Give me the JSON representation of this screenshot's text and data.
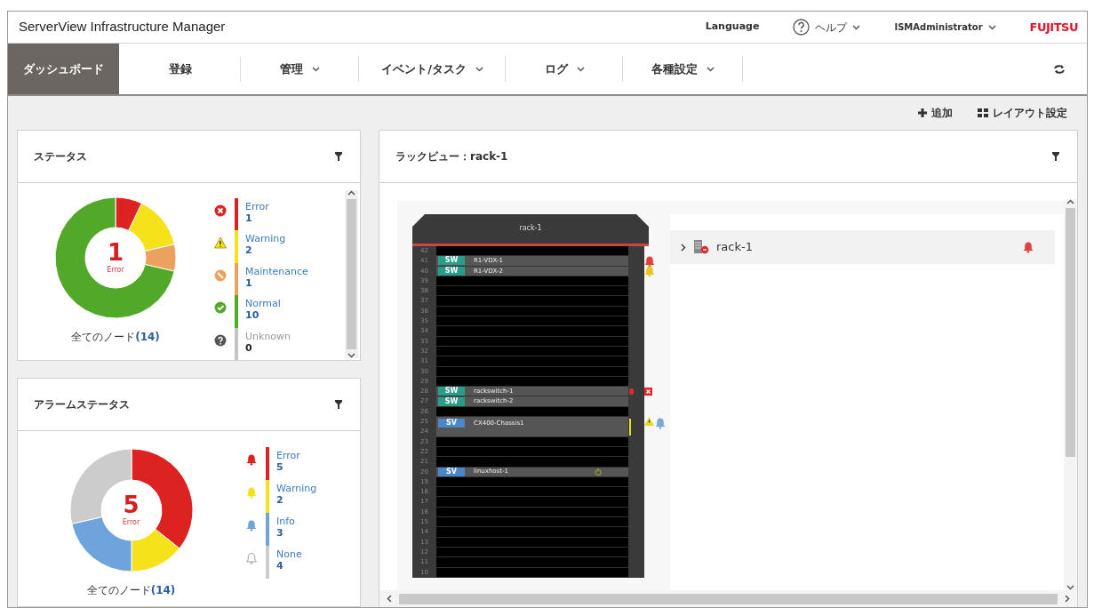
{
  "header": {
    "title": "ServerView Infrastructure Manager",
    "language": "Language",
    "help": "ヘルプ",
    "user": "ISMAdministrator",
    "logo": "FUJITSU"
  },
  "nav": {
    "tabs": [
      {
        "label": "ダッシュボード",
        "selected": true,
        "dropdown": false
      },
      {
        "label": "登録",
        "selected": false,
        "dropdown": false
      },
      {
        "label": "管理",
        "selected": false,
        "dropdown": true
      },
      {
        "label": "イベント/タスク",
        "selected": false,
        "dropdown": true
      },
      {
        "label": "ログ",
        "selected": false,
        "dropdown": true
      },
      {
        "label": "各種設定",
        "selected": false,
        "dropdown": true
      }
    ]
  },
  "toolbar": [
    {
      "kind": "add",
      "label": "追加"
    },
    {
      "kind": "layout",
      "label": "レイアウト設定"
    }
  ],
  "status_card": {
    "title": "ステータス",
    "center_value": "1",
    "center_label": "Error",
    "footer_label": "全てのノード",
    "footer_count": "(14)",
    "legend": [
      {
        "kind": "error",
        "label": "Error",
        "count": "1",
        "color": "#dd2222",
        "disabled": false
      },
      {
        "kind": "warning",
        "label": "Warning",
        "count": "2",
        "color": "#f5e21a",
        "disabled": false
      },
      {
        "kind": "maintenance",
        "label": "Maintenance",
        "count": "1",
        "color": "#eca25e",
        "disabled": false
      },
      {
        "kind": "normal",
        "label": "Normal",
        "count": "10",
        "color": "#52a828",
        "disabled": false
      },
      {
        "kind": "unknown",
        "label": "Unknown",
        "count": "0",
        "color": "#c4c4c4",
        "disabled": true
      }
    ]
  },
  "alarm_card": {
    "title": "アラームステータス",
    "center_value": "5",
    "center_label": "Error",
    "footer_label": "全てのノード",
    "footer_count": "(14)",
    "legend": [
      {
        "kind": "error-bell",
        "label": "Error",
        "count": "5",
        "color": "#dd2222",
        "disabled": false
      },
      {
        "kind": "warning-bell",
        "label": "Warning",
        "count": "2",
        "color": "#f5e21a",
        "disabled": false
      },
      {
        "kind": "info-bell",
        "label": "Info",
        "count": "3",
        "color": "#6fa3dc",
        "disabled": false
      },
      {
        "kind": "none-bell",
        "label": "None",
        "count": "4",
        "color": "#cccccc",
        "disabled": false
      }
    ]
  },
  "rack_view": {
    "title": "ラックビュー：rack-1",
    "rack": {
      "name": "rack-1",
      "slots": [
        {
          "numbers": [
            "42"
          ],
          "kind": "empty"
        },
        {
          "numbers": [
            "41"
          ],
          "kind": "switch",
          "tag": "SW",
          "name": "R1-VDX-1",
          "alarms": [
            {
              "kind": "error-bell"
            }
          ]
        },
        {
          "numbers": [
            "40"
          ],
          "kind": "switch",
          "tag": "SW",
          "name": "R1-VDX-2",
          "alarms": [
            {
              "kind": "warning-bell"
            }
          ]
        },
        {
          "numbers": [
            "39"
          ],
          "kind": "empty"
        },
        {
          "numbers": [
            "38"
          ],
          "kind": "empty"
        },
        {
          "numbers": [
            "37"
          ],
          "kind": "empty"
        },
        {
          "numbers": [
            "36"
          ],
          "kind": "empty"
        },
        {
          "numbers": [
            "35"
          ],
          "kind": "empty"
        },
        {
          "numbers": [
            "34"
          ],
          "kind": "empty"
        },
        {
          "numbers": [
            "33"
          ],
          "kind": "empty"
        },
        {
          "numbers": [
            "32"
          ],
          "kind": "empty"
        },
        {
          "numbers": [
            "31"
          ],
          "kind": "empty"
        },
        {
          "numbers": [
            "30"
          ],
          "kind": "empty"
        },
        {
          "numbers": [
            "29"
          ],
          "kind": "empty"
        },
        {
          "numbers": [
            "28"
          ],
          "kind": "switch",
          "tag": "SW",
          "name": "rackswitch-1",
          "alarms": [
            {
              "kind": "error"
            }
          ]
        },
        {
          "numbers": [
            "27"
          ],
          "kind": "switch",
          "tag": "SW",
          "name": "rackswitch-2"
        },
        {
          "numbers": [
            "26"
          ],
          "kind": "empty"
        },
        {
          "numbers": [
            "25",
            "24"
          ],
          "kind": "server",
          "tag": "SV",
          "name": "CX400-Chassis1",
          "alarms": [
            {
              "kind": "warning"
            },
            {
              "kind": "info-bell"
            }
          ]
        },
        {
          "numbers": [
            "23"
          ],
          "kind": "empty"
        },
        {
          "numbers": [
            "22"
          ],
          "kind": "empty"
        },
        {
          "numbers": [
            "21"
          ],
          "kind": "empty"
        },
        {
          "numbers": [
            "20"
          ],
          "kind": "server",
          "tag": "SV",
          "name": "linuxhost-1",
          "power_led": true
        },
        {
          "numbers": [
            "19"
          ],
          "kind": "empty"
        },
        {
          "numbers": [
            "18"
          ],
          "kind": "empty"
        },
        {
          "numbers": [
            "17"
          ],
          "kind": "empty"
        },
        {
          "numbers": [
            "16"
          ],
          "kind": "empty"
        },
        {
          "numbers": [
            "15"
          ],
          "kind": "empty"
        },
        {
          "numbers": [
            "14"
          ],
          "kind": "empty"
        },
        {
          "numbers": [
            "13"
          ],
          "kind": "empty"
        },
        {
          "numbers": [
            "12"
          ],
          "kind": "empty"
        },
        {
          "numbers": [
            "11"
          ],
          "kind": "empty"
        },
        {
          "numbers": [
            "10"
          ],
          "kind": "empty"
        }
      ]
    },
    "tree": [
      {
        "label": "rack-1",
        "expanded": false,
        "alarm": {
          "kind": "error"
        }
      }
    ]
  }
}
